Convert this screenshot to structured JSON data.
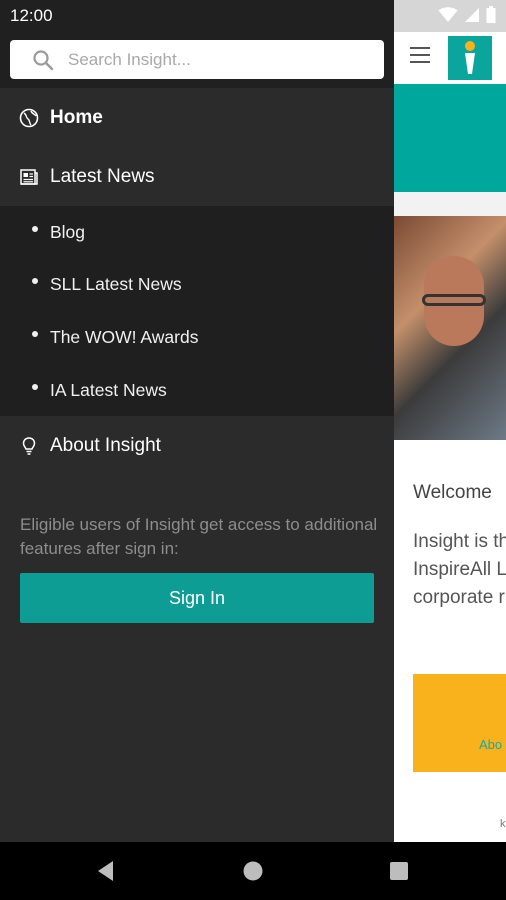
{
  "status_bar": {
    "time": "12:00",
    "icons": [
      "wifi-icon",
      "signal-icon",
      "battery-icon"
    ]
  },
  "background_app": {
    "welcome": "Welcome",
    "body_lines": [
      "Insight is th",
      "InspireAll L",
      "corporate r"
    ],
    "yellow_card_link": "Abo",
    "footer_mark": "k",
    "colors": {
      "teal": "#00a79c",
      "yellow": "#f9b21c"
    }
  },
  "drawer": {
    "search": {
      "placeholder": "Search Insight..."
    },
    "items": [
      {
        "label": "Home",
        "icon": "globe-icon"
      },
      {
        "label": "Latest News",
        "icon": "newspaper-icon"
      },
      {
        "label": "About Insight",
        "icon": "lightbulb-icon"
      }
    ],
    "subitems": [
      {
        "label": "Blog"
      },
      {
        "label": "SLL Latest News"
      },
      {
        "label": "The WOW! Awards"
      },
      {
        "label": "IA Latest News"
      }
    ],
    "info_text": "Eligible users of Insight get access to additional features after sign in:",
    "signin_label": "Sign In",
    "colors": {
      "background": "#2b2b2b",
      "subnav_background": "#1f1f1f",
      "button": "#0e9d95"
    }
  },
  "nav_bar": {
    "buttons": [
      "back-icon",
      "home-icon",
      "recents-icon"
    ]
  }
}
